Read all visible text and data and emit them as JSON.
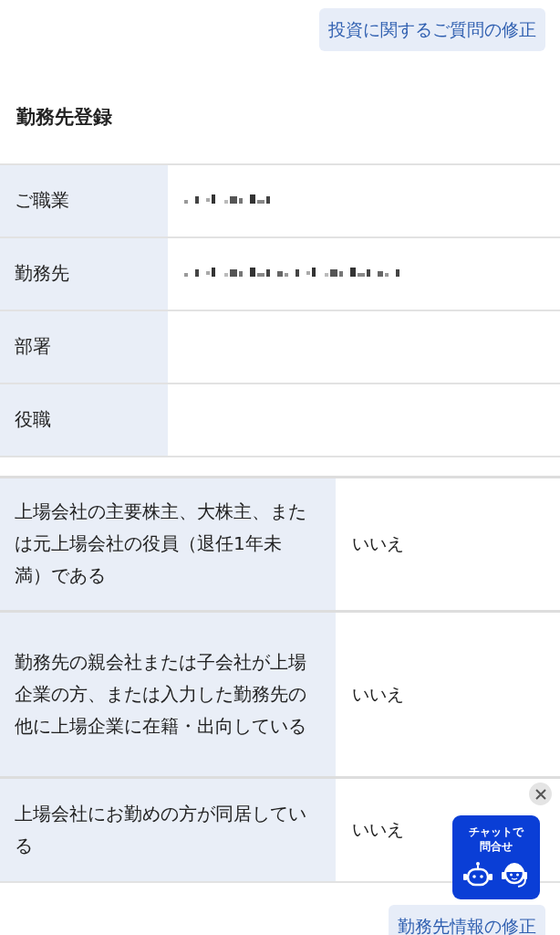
{
  "top_button": "投資に関するご質問の修正",
  "section_title": "勤務先登録",
  "employment_rows": [
    {
      "label": "ご職業",
      "redacted": true
    },
    {
      "label": "勤務先",
      "redacted": true
    },
    {
      "label": "部署",
      "redacted": false
    },
    {
      "label": "役職",
      "redacted": false
    }
  ],
  "declaration_rows": [
    {
      "label": "上場会社の主要株主、大株主、または元上場会社の役員（退任1年未満）である",
      "value": "いいえ"
    },
    {
      "label": "勤務先の親会社または子会社が上場企業の方、または入力した勤務先の他に上場企業に在籍・出向している",
      "value": "いいえ"
    },
    {
      "label": "上場会社にお勤めの方が同居している",
      "value": "いいえ"
    }
  ],
  "bottom_button": "勤務先情報の修正",
  "chat_widget": {
    "label": "チャットで問合せ"
  }
}
